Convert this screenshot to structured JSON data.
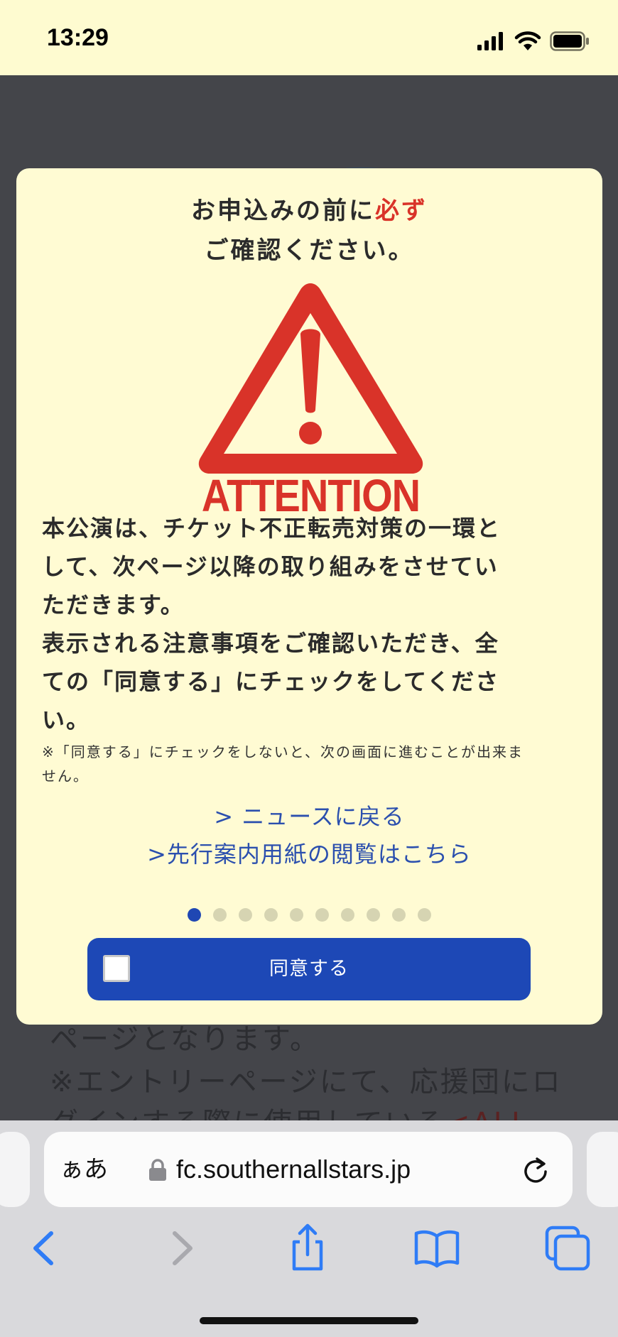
{
  "status_bar": {
    "time": "13:29"
  },
  "modal": {
    "heading_line1": "お申込みの前に",
    "heading_emphasis": "必ず",
    "heading_line2": "ご確認ください。",
    "attention_label": "ATTENTION",
    "body_lines": [
      "本公演は、チケット不正転売対策の一環と",
      "して、次ページ以降の取り組みをさせてい",
      "ただきます。",
      "表示される注意事項をご確認いただき、全",
      "ての「同意する」にチェックをしてくださ",
      "い。"
    ],
    "note_lines": [
      "※「同意する」にチェックをしないと、次の画面に進むことが出来ま",
      "せん。"
    ],
    "link_news": "> ニュースに戻る",
    "link_guide": ">先行案内用紙の閲覧はこちら",
    "pagination": {
      "total": 10,
      "current": 1
    },
    "agree_label": "同意する",
    "agree_checked": false
  },
  "background_page": {
    "lines": [
      "ページとなります。",
      "※エントリーページにて、応援団にロ",
      "グインする際に使用している"
    ],
    "red_fragment": "<ALL"
  },
  "browser": {
    "text_size_label": "ぁあ",
    "url": "fc.southernallstars.jp",
    "accent_color": "#2f7cf6"
  },
  "colors": {
    "accent_red": "#d93329",
    "button_blue": "#1d48b6",
    "link_blue": "#2b4fae",
    "modal_bg": "#fffbd3"
  }
}
